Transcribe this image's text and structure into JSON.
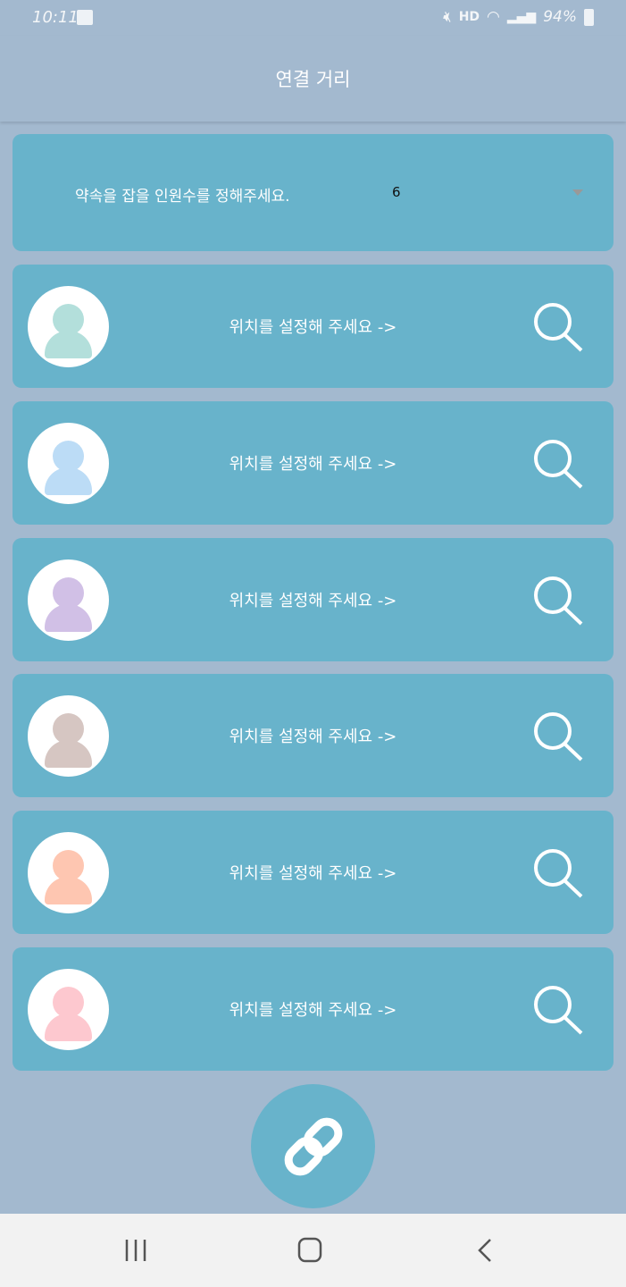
{
  "status_bar": {
    "time": "10:11",
    "hd": "HD",
    "battery": "94%"
  },
  "header": {
    "title": "연결 거리"
  },
  "count_select": {
    "label": "약속을 잡을 인원수를 정해주세요.",
    "value": "6"
  },
  "rows": [
    {
      "text": "위치를 설정해 주세요 ->",
      "avatar_color": "#b3dfdb"
    },
    {
      "text": "위치를 설정해 주세요 ->",
      "avatar_color": "#bcdcf6"
    },
    {
      "text": "위치를 설정해 주세요 ->",
      "avatar_color": "#d1c0e6"
    },
    {
      "text": "위치를 설정해 주세요 ->",
      "avatar_color": "#d6c6c2"
    },
    {
      "text": "위치를 설정해 주세요 ->",
      "avatar_color": "#fec6b1"
    },
    {
      "text": "위치를 설정해 주세요 ->",
      "avatar_color": "#fdc8cf"
    }
  ]
}
